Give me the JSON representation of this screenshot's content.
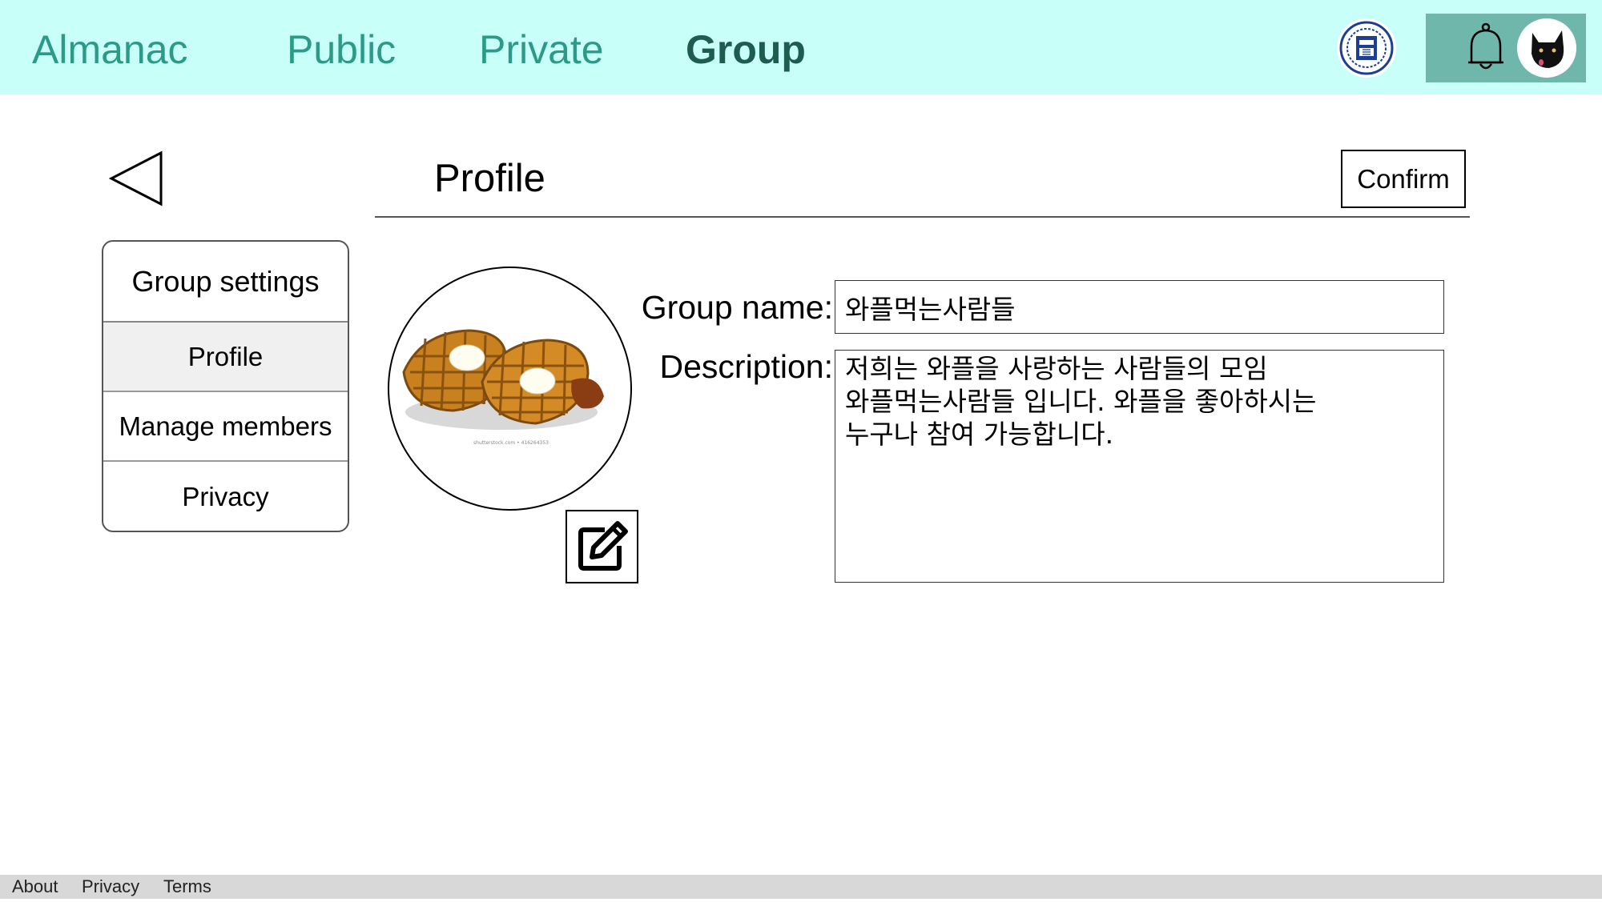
{
  "nav": {
    "brand": "Almanac",
    "tabs": [
      {
        "label": "Public"
      },
      {
        "label": "Private"
      },
      {
        "label": "Group",
        "active": true
      }
    ],
    "icons": {
      "university_logo": "university-seal-icon",
      "notifications": "bell-icon",
      "profile": "dog-avatar"
    }
  },
  "header": {
    "title": "Profile",
    "confirm_label": "Confirm",
    "back_icon": "back-triangle-icon"
  },
  "sidebar": {
    "heading": "Group settings",
    "items": [
      {
        "label": "Profile",
        "selected": true
      },
      {
        "label": "Manage members"
      },
      {
        "label": "Privacy"
      }
    ]
  },
  "profile_form": {
    "group_image": "waffles-image",
    "group_image_caption": "shutterstock.com • 416264353",
    "edit_icon": "pencil-edit-icon",
    "name_label": "Group name:",
    "name_value": "와플먹는사람들",
    "description_label": "Description:",
    "description_value": "저희는 와플을 사랑하는 사람들의 모임\n와플먹는사람들 입니다. 와플을 좋아하시는\n누구나 참여 가능합니다."
  },
  "footer": {
    "links": [
      "About",
      "Privacy",
      "Terms"
    ]
  },
  "colors": {
    "topbar_bg": "#c8fff9",
    "nav_text": "#2b9a86",
    "nav_active": "#1e5c50",
    "icon_panel_bg": "#6fb7ab",
    "footer_bg": "#d8d8d8"
  }
}
